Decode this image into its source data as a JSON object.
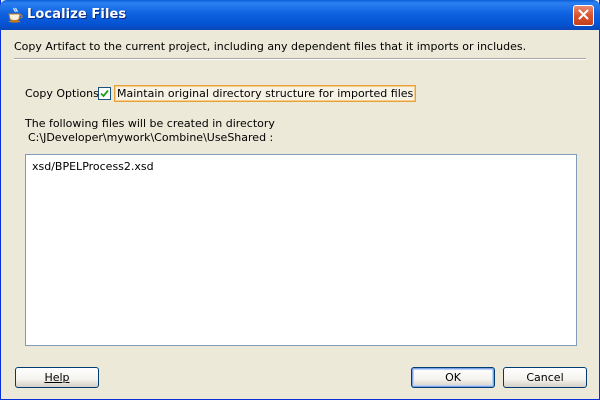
{
  "window": {
    "title": "Localize Files",
    "app_icon": "coffee-cup-icon",
    "close_icon": "close-icon"
  },
  "header": {
    "description": "Copy Artifact to the current project, including any dependent files that it imports or includes."
  },
  "options": {
    "label": "Copy Options:",
    "checkbox_checked": true,
    "checkbox_label": "Maintain original directory structure for imported files"
  },
  "info": {
    "line1": "The following files will be created in directory",
    "line2": "C:\\JDeveloper\\mywork\\Combine\\UseShared :"
  },
  "files": [
    "xsd/BPELProcess2.xsd"
  ],
  "buttons": {
    "help": "Help",
    "ok": "OK",
    "cancel": "Cancel"
  }
}
